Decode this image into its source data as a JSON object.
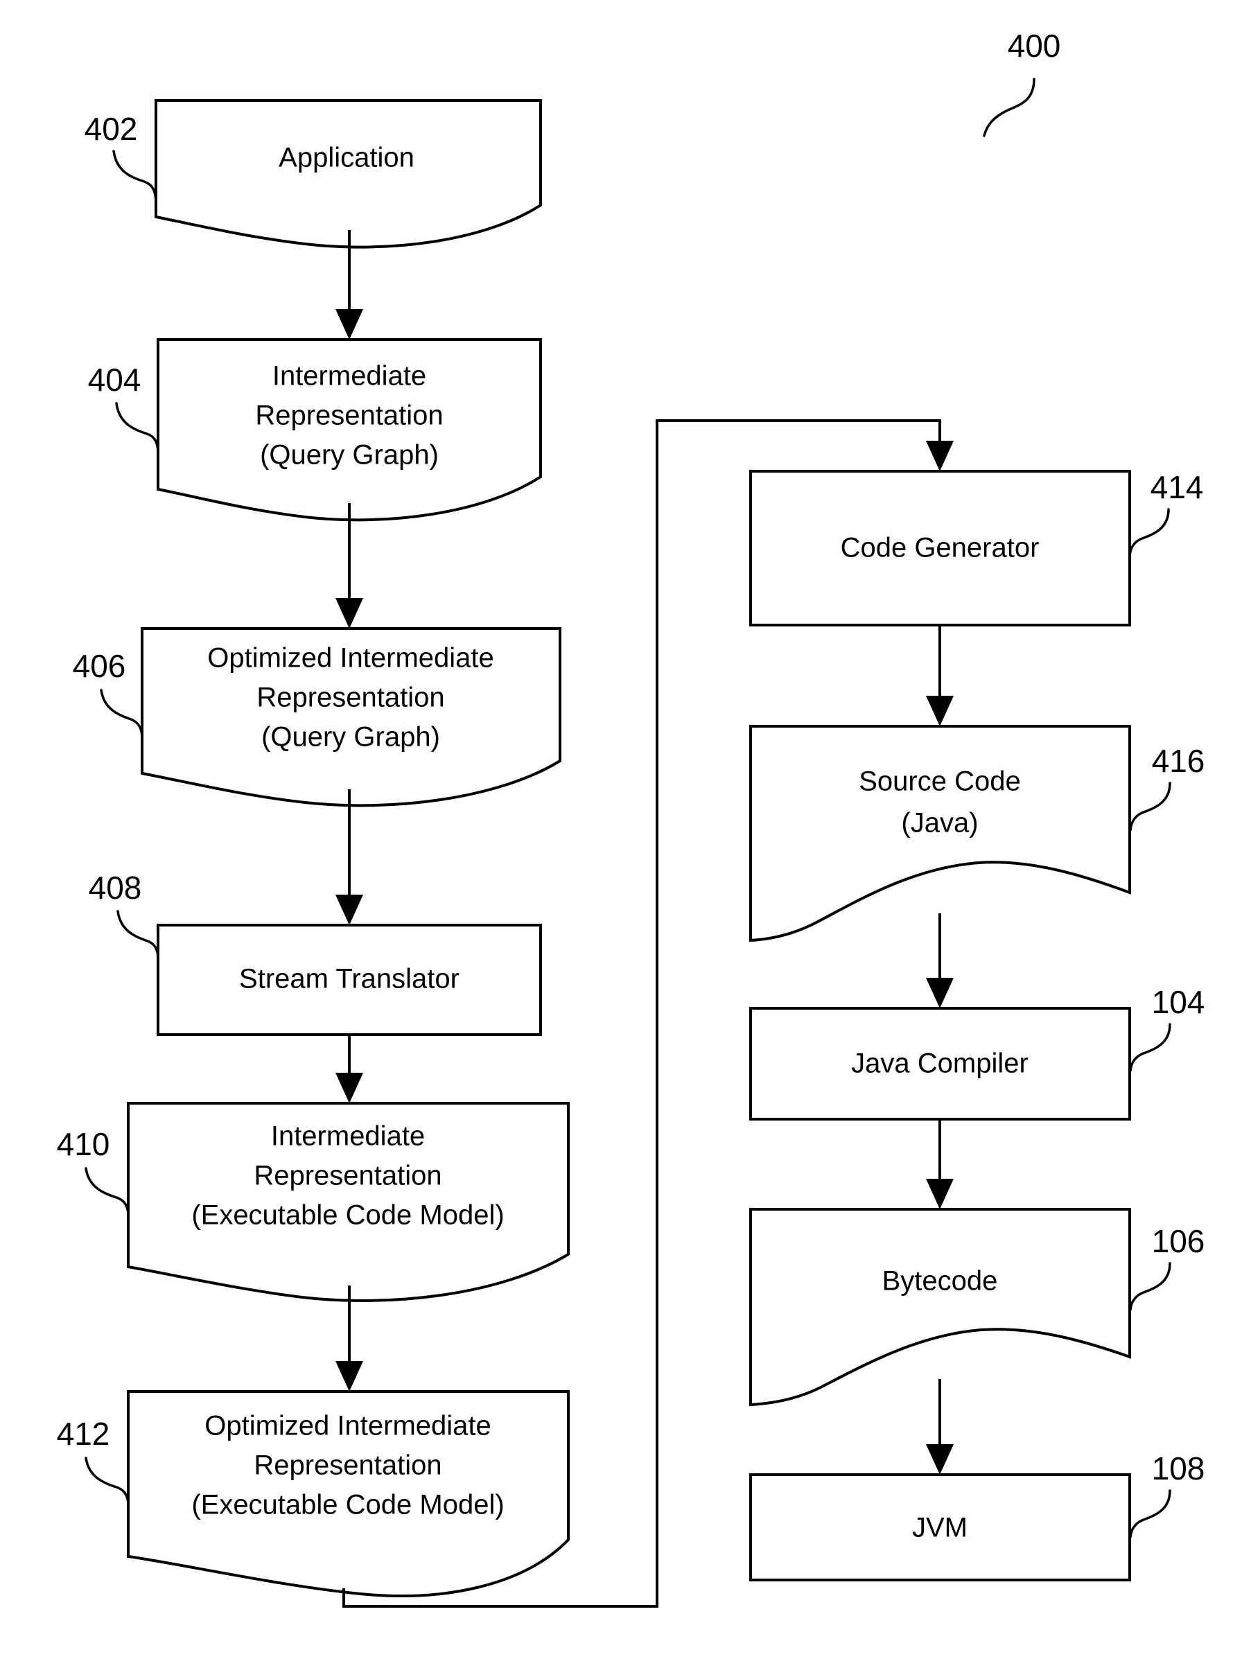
{
  "figure": {
    "number": "400",
    "type": "flowchart"
  },
  "nodes": [
    {
      "ref": "402",
      "label_lines": [
        "Application"
      ],
      "shape": "torn-bottom",
      "column": "left"
    },
    {
      "ref": "404",
      "label_lines": [
        "Intermediate",
        "Representation",
        "(Query Graph)"
      ],
      "shape": "torn-bottom",
      "column": "left"
    },
    {
      "ref": "406",
      "label_lines": [
        "Optimized Intermediate",
        "Representation",
        "(Query Graph)"
      ],
      "shape": "torn-bottom",
      "column": "left"
    },
    {
      "ref": "408",
      "label_lines": [
        "Stream Translator"
      ],
      "shape": "rectangle",
      "column": "left"
    },
    {
      "ref": "410",
      "label_lines": [
        "Intermediate",
        "Representation",
        "(Executable Code Model)"
      ],
      "shape": "torn-bottom",
      "column": "left"
    },
    {
      "ref": "412",
      "label_lines": [
        "Optimized Intermediate",
        "Representation",
        "(Executable Code Model)"
      ],
      "shape": "torn-bottom",
      "column": "left"
    },
    {
      "ref": "414",
      "label_lines": [
        "Code Generator"
      ],
      "shape": "rectangle",
      "column": "right"
    },
    {
      "ref": "416",
      "label_lines": [
        "Source Code",
        "(Java)"
      ],
      "shape": "torn-bottom",
      "column": "right"
    },
    {
      "ref": "104",
      "label_lines": [
        "Java Compiler"
      ],
      "shape": "rectangle",
      "column": "right"
    },
    {
      "ref": "106",
      "label_lines": [
        "Bytecode"
      ],
      "shape": "torn-bottom",
      "column": "right"
    },
    {
      "ref": "108",
      "label_lines": [
        "JVM"
      ],
      "shape": "rectangle",
      "column": "right"
    }
  ],
  "labels": {
    "n402": "402",
    "n404": "404",
    "n406": "406",
    "n408": "408",
    "n410": "410",
    "n412": "412",
    "n414": "414",
    "n416": "416",
    "n104": "104",
    "n106": "106",
    "n108": "108",
    "fig400": "400"
  },
  "text": {
    "application": "Application",
    "intermediate": "Intermediate",
    "representation": "Representation",
    "query_graph": "(Query Graph)",
    "optimized_intermediate": "Optimized Intermediate",
    "stream_translator": "Stream Translator",
    "exec_code_model": "(Executable Code Model)",
    "code_generator": "Code Generator",
    "source_code": "Source Code",
    "java": "(Java)",
    "java_compiler": "Java Compiler",
    "bytecode": "Bytecode",
    "jvm": "JVM"
  },
  "colors": {
    "stroke": "#000000",
    "fill": "#ffffff",
    "background": "#ffffff"
  },
  "flow": {
    "edges": [
      {
        "from": "402",
        "to": "404"
      },
      {
        "from": "404",
        "to": "406"
      },
      {
        "from": "406",
        "to": "408"
      },
      {
        "from": "408",
        "to": "410"
      },
      {
        "from": "410",
        "to": "412"
      },
      {
        "from": "412",
        "to": "414",
        "style": "routed-feedback"
      },
      {
        "from": "414",
        "to": "416"
      },
      {
        "from": "416",
        "to": "104"
      },
      {
        "from": "104",
        "to": "106"
      },
      {
        "from": "106",
        "to": "108"
      }
    ]
  }
}
